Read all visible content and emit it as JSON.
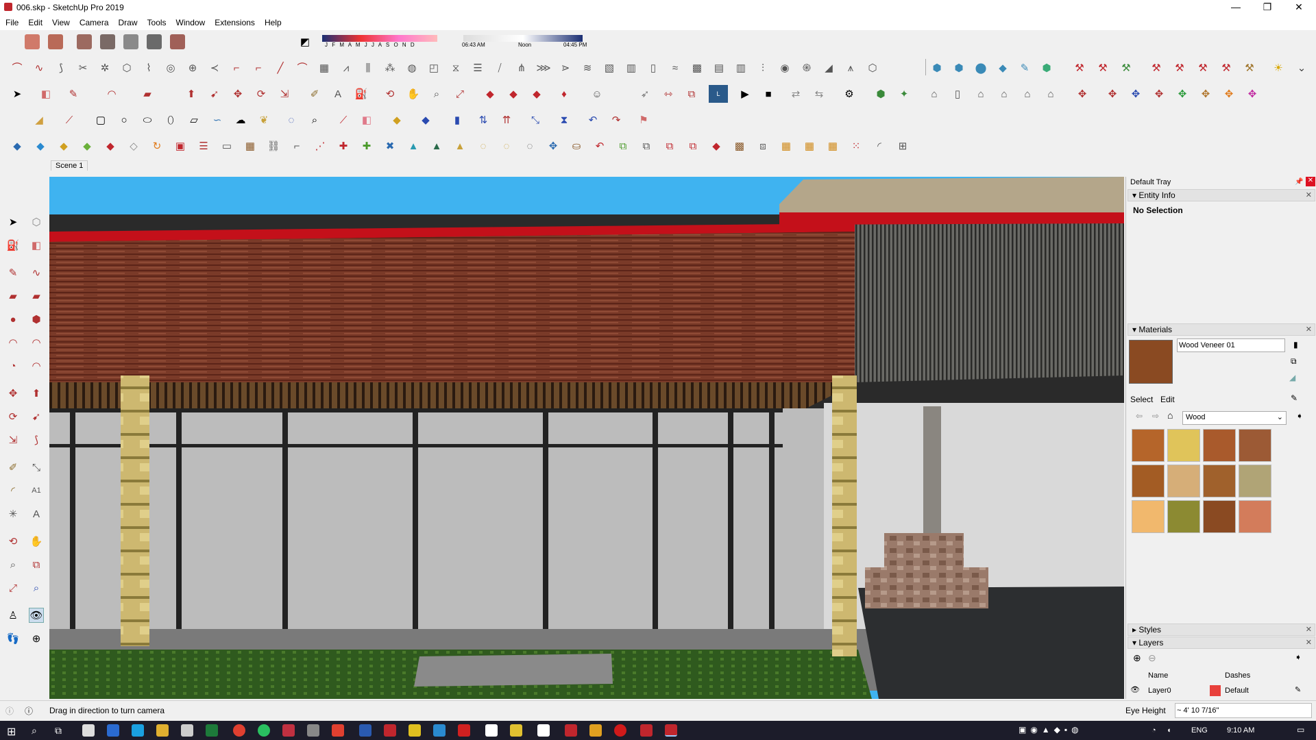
{
  "window": {
    "title": "006.skp - SketchUp Pro 2019",
    "minimize": "—",
    "maximize": "❐",
    "close": "✕"
  },
  "menu": [
    "File",
    "Edit",
    "View",
    "Camera",
    "Draw",
    "Tools",
    "Window",
    "Extensions",
    "Help"
  ],
  "shadow": {
    "months": "J F M A M J J A S O N D",
    "time_start": "06:43 AM",
    "time_mid": "Noon",
    "time_end": "04:45 PM"
  },
  "scene_tab": "Scene 1",
  "tray": {
    "title": "Default Tray",
    "entity_info": {
      "header": "Entity Info",
      "status": "No Selection"
    },
    "materials": {
      "header": "Materials",
      "name_value": "Wood Veneer 01",
      "tab_select": "Select",
      "tab_edit": "Edit",
      "library": "Wood",
      "swatch_colors": [
        "#b5652a",
        "#e0c45a",
        "#a95a2c",
        "#9c5a35",
        "#a35c24",
        "#d6ae78",
        "#a0612c",
        "#b0a476",
        "#f1b86d",
        "#8c8a32",
        "#8a4a22",
        "#d37c5b"
      ]
    },
    "styles": {
      "header": "Styles"
    },
    "layers": {
      "header": "Layers",
      "col_name": "Name",
      "col_dashes": "Dashes",
      "layer_name": "Layer0",
      "layer_dashes": "Default",
      "layer_color": "#e8403b"
    }
  },
  "status": {
    "hint": "Drag in direction to turn camera",
    "eye_height_label": "Eye Height",
    "eye_height_value": "~ 4' 10 7/16\""
  },
  "taskbar": {
    "lang": "ENG",
    "clock": "9:10 AM"
  },
  "colors": {
    "accent": "#c0262d",
    "sky": "#3fb3f0",
    "roof_trim": "#c4101a"
  }
}
